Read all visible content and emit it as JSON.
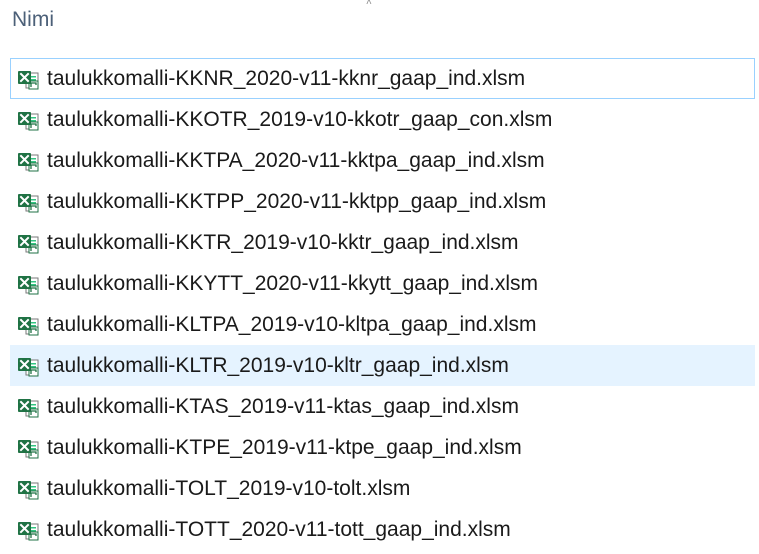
{
  "column_header": {
    "name_label": "Nimi"
  },
  "file_list": {
    "items": [
      {
        "name": "taulukkomalli-KKNR_2020-v11-kknr_gaap_ind.xlsm",
        "icon": "excel-macro-file-icon",
        "state": "focused"
      },
      {
        "name": "taulukkomalli-KKOTR_2019-v10-kkotr_gaap_con.xlsm",
        "icon": "excel-macro-file-icon",
        "state": ""
      },
      {
        "name": "taulukkomalli-KKTPA_2020-v11-kktpa_gaap_ind.xlsm",
        "icon": "excel-macro-file-icon",
        "state": ""
      },
      {
        "name": "taulukkomalli-KKTPP_2020-v11-kktpp_gaap_ind.xlsm",
        "icon": "excel-macro-file-icon",
        "state": ""
      },
      {
        "name": "taulukkomalli-KKTR_2019-v10-kktr_gaap_ind.xlsm",
        "icon": "excel-macro-file-icon",
        "state": ""
      },
      {
        "name": "taulukkomalli-KKYTT_2020-v11-kkytt_gaap_ind.xlsm",
        "icon": "excel-macro-file-icon",
        "state": ""
      },
      {
        "name": "taulukkomalli-KLTPA_2019-v10-kltpa_gaap_ind.xlsm",
        "icon": "excel-macro-file-icon",
        "state": ""
      },
      {
        "name": "taulukkomalli-KLTR_2019-v10-kltr_gaap_ind.xlsm",
        "icon": "excel-macro-file-icon",
        "state": "hovered"
      },
      {
        "name": "taulukkomalli-KTAS_2019-v11-ktas_gaap_ind.xlsm",
        "icon": "excel-macro-file-icon",
        "state": ""
      },
      {
        "name": "taulukkomalli-KTPE_2019-v11-ktpe_gaap_ind.xlsm",
        "icon": "excel-macro-file-icon",
        "state": ""
      },
      {
        "name": "taulukkomalli-TOLT_2019-v10-tolt.xlsm",
        "icon": "excel-macro-file-icon",
        "state": ""
      },
      {
        "name": "taulukkomalli-TOTT_2020-v11-tott_gaap_ind.xlsm",
        "icon": "excel-macro-file-icon",
        "state": ""
      }
    ]
  },
  "colors": {
    "header_text": "#4c6078",
    "focus_border": "#99d1ff",
    "hover_background": "#e5f3ff",
    "excel_green": "#1f7244",
    "excel_light_green": "#33c481"
  }
}
